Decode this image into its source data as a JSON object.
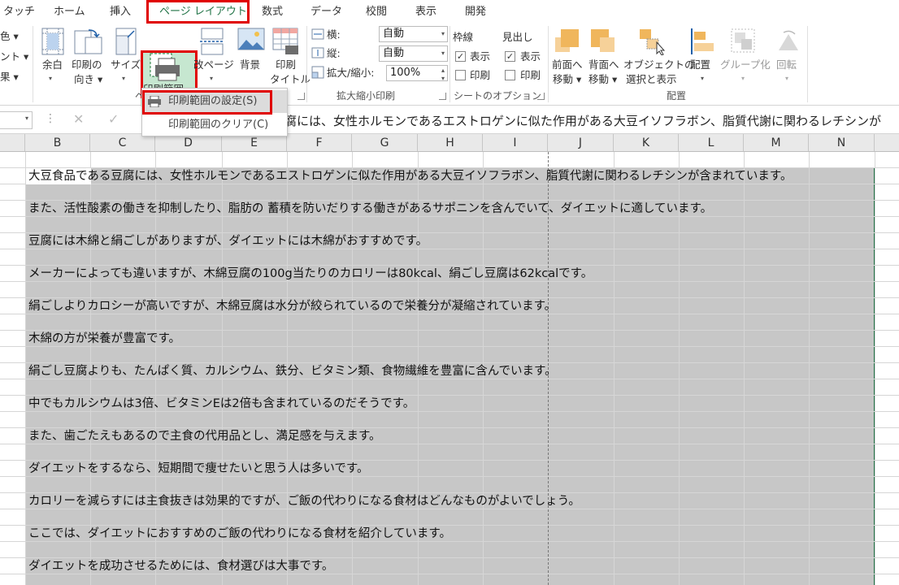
{
  "tabs": [
    {
      "label": "タッチ"
    },
    {
      "label": "ホーム"
    },
    {
      "label": "挿入"
    },
    {
      "label": "ページ レイアウト"
    },
    {
      "label": "数式"
    },
    {
      "label": "データ"
    },
    {
      "label": "校閲"
    },
    {
      "label": "表示"
    },
    {
      "label": "開発"
    }
  ],
  "ribbon": {
    "left_partial": [
      "色 ▾",
      "ント ▾",
      "果 ▾"
    ],
    "margins": {
      "label": "余白",
      "arrow": "▾"
    },
    "orientation": {
      "line1": "印刷の",
      "line2": "向き ▾"
    },
    "size": {
      "label": "サイズ",
      "arrow": "▾"
    },
    "print_area": {
      "label": "印刷範囲",
      "arrow": "▾"
    },
    "breaks": {
      "label": "改ページ",
      "arrow": "▾"
    },
    "background": {
      "label": "背景"
    },
    "print_titles": {
      "line1": "印刷",
      "line2": "タイトル"
    },
    "page_setup_group_partial": "ペ",
    "scale": {
      "width_label": "横:",
      "width_value": "自動",
      "height_label": "縦:",
      "height_value": "自動",
      "zoom_label": "拡大/縮小:",
      "zoom_value": "100%",
      "group": "拡大縮小印刷"
    },
    "sheet_options": {
      "gridlines": "枠線",
      "headings": "見出し",
      "view": "表示",
      "print": "印刷",
      "group": "シートのオプション"
    },
    "arrange": {
      "bring_forward": {
        "line1": "前面へ",
        "line2": "移動 ▾"
      },
      "send_backward": {
        "line1": "背面へ",
        "line2": "移動 ▾"
      },
      "selection_pane": {
        "line1": "オブジェクトの",
        "line2": "選択と表示"
      },
      "align": {
        "label": "配置",
        "arrow": "▾"
      },
      "group_btn": {
        "label": "グループ化",
        "arrow": "▾"
      },
      "rotate": {
        "label": "回転",
        "arrow": "▾"
      },
      "group": "配置"
    }
  },
  "menu": {
    "set_print_area": "印刷範囲の設定(S)",
    "clear_print_area": "印刷範囲のクリア(C)"
  },
  "formula_bar": {
    "cancel": "✕",
    "enter": "✓",
    "fx_dots": "⋮",
    "content": "腐には、女性ホルモンであるエストロゲンに似た作用がある大豆イソフラボン、脂質代謝に関わるレチシンが"
  },
  "columns": [
    "B",
    "C",
    "D",
    "E",
    "F",
    "G",
    "H",
    "I",
    "J",
    "K",
    "L",
    "M",
    "N"
  ],
  "rows": [
    "大豆食品である豆腐には、女性ホルモンであるエストロゲンに似た作用がある大豆イソフラボン、脂質代謝に関わるレチシンが含まれています。",
    "また、活性酸素の働きを抑制したり、脂肪の 蓄積を防いだりする働きがあるサポニンを含んでいて、ダイエットに適しています。",
    "豆腐には木綿と絹ごしがありますが、ダイエットには木綿がおすすめです。",
    "メーカーによっても違いますが、木綿豆腐の100g当たりのカロリーは80kcal、絹ごし豆腐は62kcalです。",
    "絹ごしよりカロシーが高いですが、木綿豆腐は水分が絞られているので栄養分が凝縮されています。",
    "木綿の方が栄養が豊富です。",
    "絹ごし豆腐よりも、たんぱく質、カルシウム、鉄分、ビタミン類、食物繊維を豊富に含んでいます。",
    "中でもカルシウムは3倍、ビタミンEは2倍も含まれているのだそうです。",
    "また、歯ごたえもあるので主食の代用品とし、満足感を与えます。",
    "ダイエットをするなら、短期間で痩せたいと思う人は多いです。",
    "カロリーを減らすには主食抜きは効果的ですが、ご飯の代わりになる食材はどんなものがよいでしょう。",
    "ここでは、ダイエットにおすすめのご飯の代わりになる食材を紹介しています。",
    "ダイエットを成功させるためには、食材選びは大事です。"
  ],
  "colors": {
    "accent": "#217346",
    "highlight": "#e00000",
    "selection": "#c7c7c7"
  }
}
